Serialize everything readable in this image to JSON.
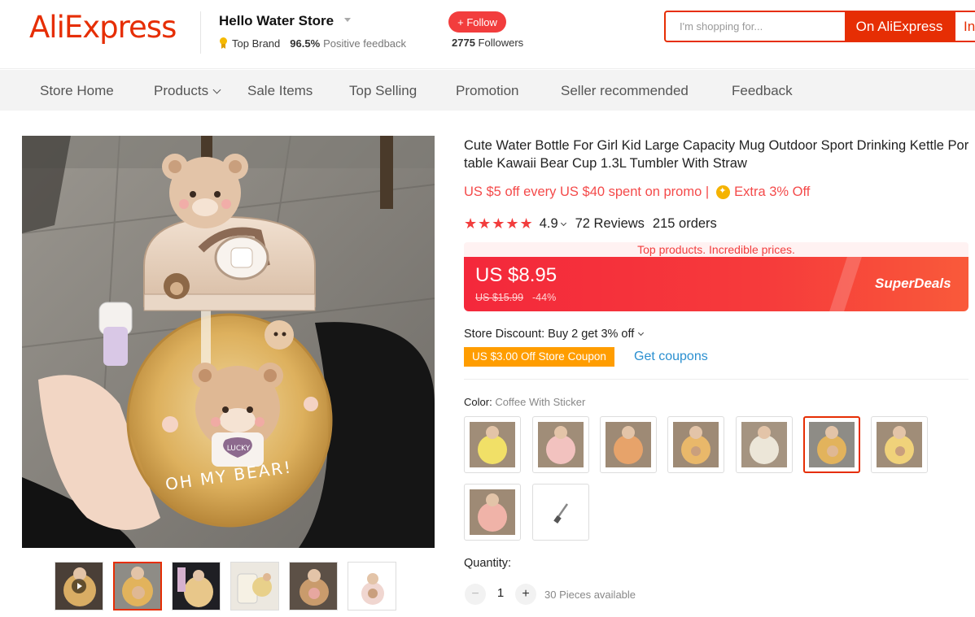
{
  "header": {
    "logo": "AliExpress",
    "store_name": "Hello Water Store",
    "top_brand": "Top Brand",
    "feedback_pct": "96.5%",
    "feedback_label": "Positive feedback",
    "follow_label": "+ Follow",
    "followers_count": "2775",
    "followers_label": "Followers",
    "search_placeholder": "I'm shopping for...",
    "btn_on_ali": "On AliExpress",
    "btn_in_store": "In this store"
  },
  "nav": {
    "items": [
      "Store Home",
      "Products",
      "Sale Items",
      "Top Selling",
      "Promotion",
      "Seller recommended",
      "Feedback"
    ]
  },
  "product": {
    "title": "Cute Water Bottle For Girl Kid Large Capacity Mug Outdoor Sport Drinking Kettle Portable Kawaii Bear Cup 1.3L Tumbler With Straw",
    "promo_text": "US $5 off every US $40 spent on promo |",
    "extra_off": "Extra 3% Off",
    "stars": "★★★★★",
    "rating": "4.9",
    "reviews": "72 Reviews",
    "orders": "215 orders",
    "deal_top_text": "Top products. Incredible prices.",
    "price": "US $8.95",
    "old_price": "US $15.99",
    "discount": "-44%",
    "superdeals": "SuperDeals",
    "store_discount": "Store Discount: Buy 2 get 3% off",
    "coupon": "US $3.00 Off Store Coupon",
    "get_coupons": "Get coupons",
    "color_label": "Color:",
    "color_value": "Coffee With Sticker",
    "selected_swatch_index": 5,
    "quantity_label": "Quantity:",
    "quantity_minus": "−",
    "quantity_value": "1",
    "quantity_plus": "+",
    "available": "30 Pieces available"
  },
  "gallery": {
    "bottle_text": "OH MY BEAR!",
    "bear_label": "LUCKY",
    "active_thumb_index": 1
  },
  "colors": {
    "brand_red": "#e62e04",
    "deal_red": "#f4283b",
    "coupon_orange": "#ff9d00",
    "link_blue": "#2a8fd0"
  }
}
